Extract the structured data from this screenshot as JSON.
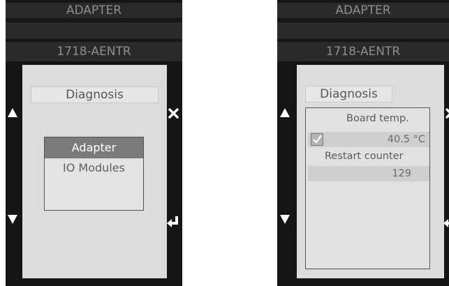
{
  "left": {
    "header": "ADAPTER",
    "device": "1718-AENTR",
    "title": "Diagnosis",
    "menu": [
      {
        "label": "Adapter",
        "selected": true
      },
      {
        "label": "IO Modules",
        "selected": false
      }
    ]
  },
  "right": {
    "header": "ADAPTER",
    "device": "1718-AENTR",
    "title": "Diagnosis",
    "board_temp_label": "Board temp.",
    "board_temp_value": "40.5 °C",
    "restart_label": "Restart counter",
    "restart_value": "129"
  },
  "icons": {
    "up": "up-triangle-icon",
    "down": "down-triangle-icon",
    "close": "close-icon",
    "enter": "enter-icon",
    "check": "checkbox-checked-icon"
  },
  "colors": {
    "bezel": "#151515",
    "panel": "#dcdcdc",
    "selected": "#7a7a7a"
  }
}
